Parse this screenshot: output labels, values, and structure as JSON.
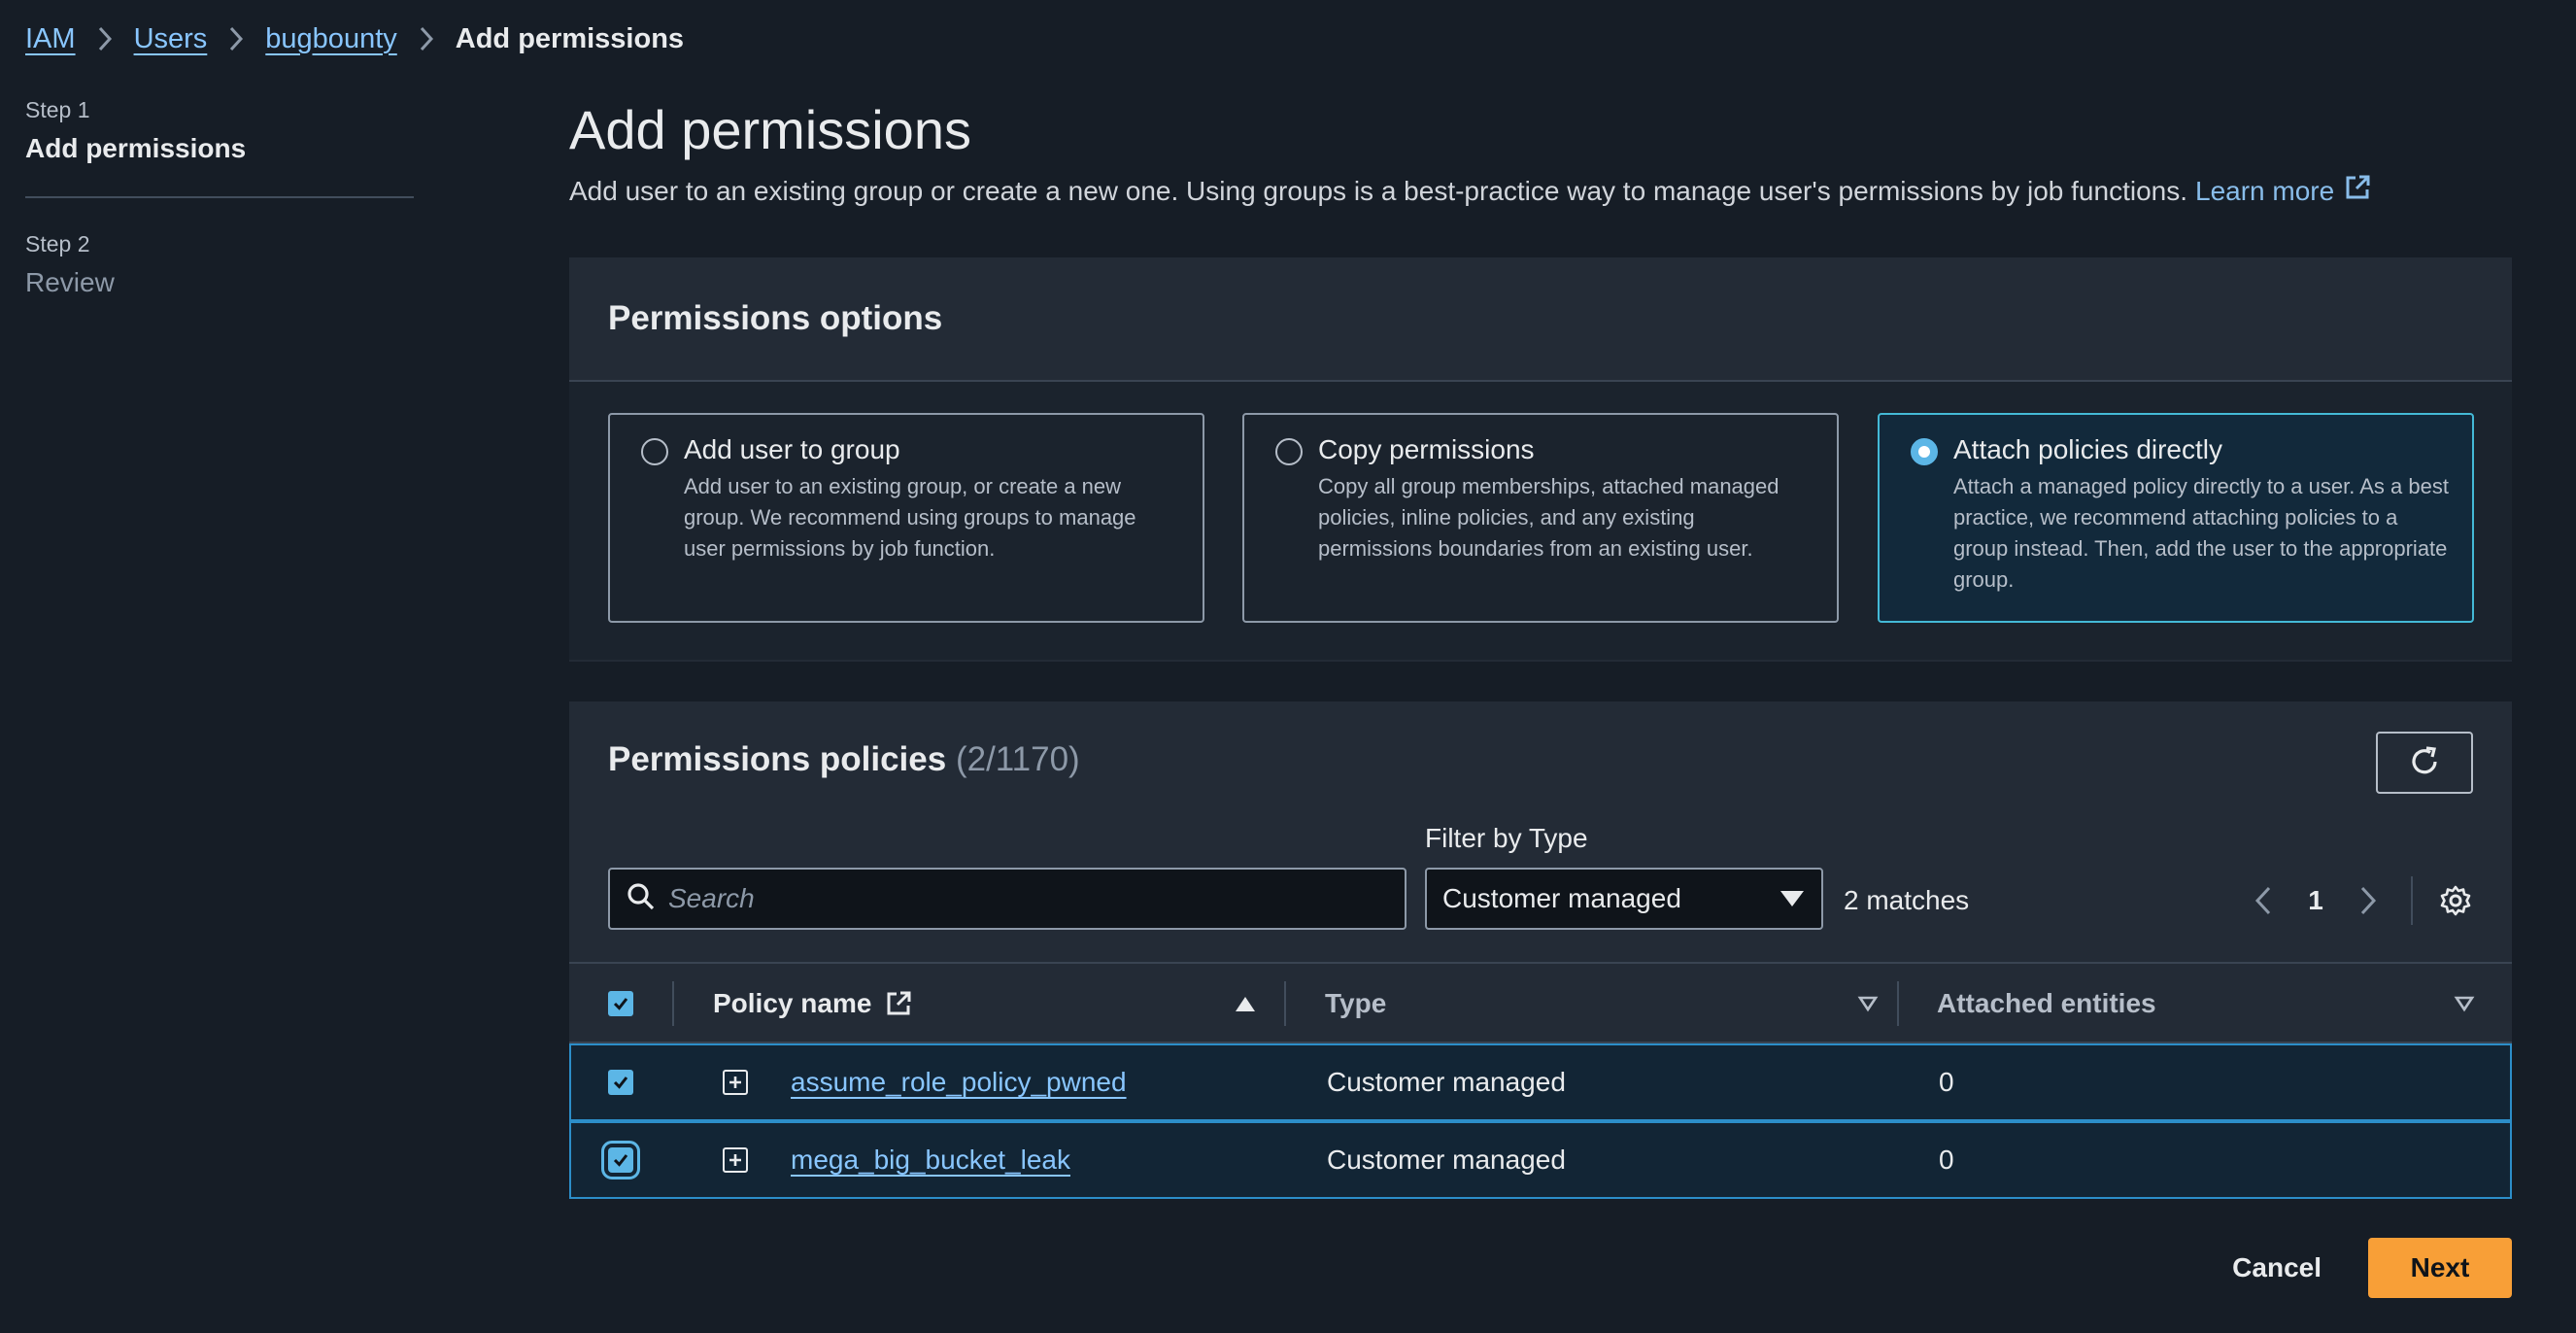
{
  "breadcrumb": {
    "items": [
      "IAM",
      "Users",
      "bugbounty"
    ],
    "current": "Add permissions"
  },
  "steps": [
    {
      "num": "Step 1",
      "title": "Add permissions"
    },
    {
      "num": "Step 2",
      "title": "Review"
    }
  ],
  "header": {
    "title": "Add permissions",
    "description": "Add user to an existing group or create a new one. Using groups is a best-practice way to manage user's permissions by job functions.",
    "learn_more": "Learn more"
  },
  "options": {
    "title": "Permissions options",
    "cards": [
      {
        "title": "Add user to group",
        "desc": "Add user to an existing group, or create a new group. We recommend using groups to manage user permissions by job function.",
        "selected": false
      },
      {
        "title": "Copy permissions",
        "desc": "Copy all group memberships, attached managed policies, inline policies, and any existing permissions boundaries from an existing user.",
        "selected": false
      },
      {
        "title": "Attach policies directly",
        "desc": "Attach a managed policy directly to a user. As a best practice, we recommend attaching policies to a group instead. Then, add the user to the appropriate group.",
        "selected": true
      }
    ]
  },
  "policies": {
    "title": "Permissions policies",
    "count": "(2/1170)",
    "filter_label": "Filter by Type",
    "search_placeholder": "Search",
    "filter_value": "Customer managed",
    "matches": "2 matches",
    "page": "1",
    "columns": {
      "name": "Policy name",
      "type": "Type",
      "entities": "Attached entities"
    },
    "rows": [
      {
        "name": "assume_role_policy_pwned",
        "type": "Customer managed",
        "entities": "0",
        "checked": true
      },
      {
        "name": "mega_big_bucket_leak",
        "type": "Customer managed",
        "entities": "0",
        "checked": true
      }
    ]
  },
  "footer": {
    "cancel": "Cancel",
    "next": "Next"
  },
  "colors": {
    "accent": "#5cb6e6",
    "primary_button": "#f89f37",
    "background": "#161d26",
    "panel": "#232b36"
  }
}
